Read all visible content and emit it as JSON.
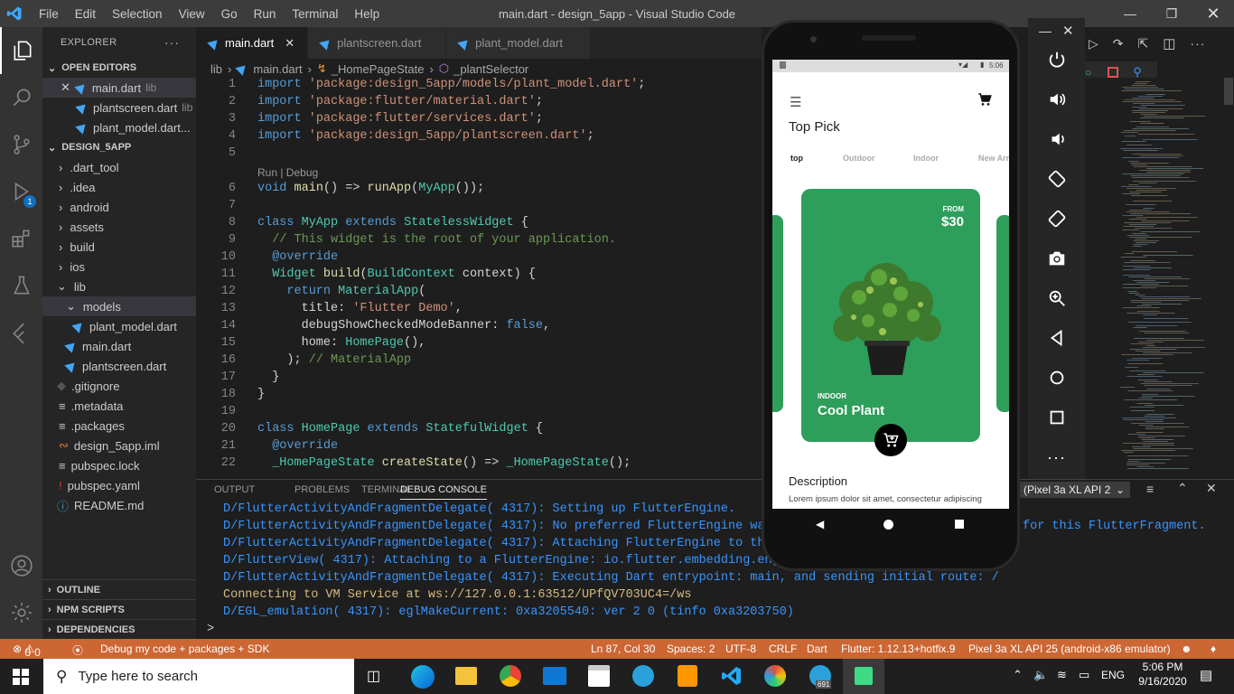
{
  "window": {
    "title": "main.dart - design_5app - Visual Studio Code",
    "menu": [
      "File",
      "Edit",
      "Selection",
      "View",
      "Go",
      "Run",
      "Terminal",
      "Help"
    ]
  },
  "sidebar": {
    "title": "EXPLORER",
    "open_editors_label": "OPEN EDITORS",
    "open_editors": [
      {
        "name": "main.dart",
        "hint": "lib"
      },
      {
        "name": "plantscreen.dart",
        "hint": "lib"
      },
      {
        "name": "plant_model.dart..."
      }
    ],
    "project_label": "DESIGN_5APP",
    "tree": [
      ".dart_tool",
      ".idea",
      "android",
      "assets",
      "build",
      "ios",
      "lib",
      "models",
      "plant_model.dart",
      "main.dart",
      "plantscreen.dart",
      ".gitignore",
      ".metadata",
      ".packages",
      "design_5app.iml",
      "pubspec.lock",
      "pubspec.yaml",
      "README.md"
    ],
    "outline": "OUTLINE",
    "npm": "NPM SCRIPTS",
    "deps": "DEPENDENCIES",
    "debug_badge": "1"
  },
  "tabs": [
    "main.dart",
    "plantscreen.dart",
    "plant_model.dart"
  ],
  "breadcrumb": [
    "lib",
    "main.dart",
    "_HomePageState",
    "_plantSelector"
  ],
  "editor": {
    "codelens": "Run | Debug",
    "line_numbers": [
      "1",
      "2",
      "3",
      "4",
      "5",
      "6",
      "7",
      "8",
      "9",
      "10",
      "11",
      "12",
      "13",
      "14",
      "15",
      "16",
      "17",
      "18",
      "19",
      "20",
      "21",
      "22"
    ]
  },
  "panel": {
    "tabs": [
      "OUTPUT",
      "PROBLEMS",
      "TERMINAL",
      "DEBUG CONSOLE"
    ],
    "device": "(Pixel 3a XL API 2",
    "console": [
      "D/FlutterActivityAndFragmentDelegate( 4317): Setting up FlutterEngine.",
      "D/FlutterActivityAndFragmentDelegate( 4317): No preferred FlutterEngine was p",
      "D/FlutterActivityAndFragmentDelegate( 4317): Attaching FlutterEngine to the A",
      "D/FlutterView( 4317): Attaching to a FlutterEngine: io.flutter.embedding.engine",
      "D/FlutterActivityAndFragmentDelegate( 4317): Executing Dart entrypoint: main, and sending initial route: /",
      "Connecting to VM Service at ws://127.0.0.1:63512/UPfQV703UC4=/ws",
      "D/EGL_emulation( 4317): eglMakeCurrent: 0xa3205540: ver 2 0 (tinfo 0xa3203750)"
    ],
    "console_tail": "for this FlutterFragment.",
    "prompt": ">"
  },
  "status": {
    "errors": "0",
    "warnings": "0",
    "debug": "Debug my code + packages + SDK",
    "position": "Ln 87, Col 30",
    "spaces": "Spaces: 2",
    "encoding": "UTF-8",
    "eol": "CRLF",
    "lang": "Dart",
    "flutter": "Flutter: 1.12.13+hotfix.9",
    "device": "Pixel 3a XL API 25 (android-x86 emulator)"
  },
  "taskbar": {
    "search_placeholder": "Type here to search",
    "time": "5:06 PM",
    "date": "9/16/2020",
    "lang": "ENG",
    "badge": "691"
  },
  "app": {
    "statusbar_time": "5:06",
    "title": "Top Pick",
    "tabs": [
      "top",
      "Outdoor",
      "Indoor",
      "New Arr"
    ],
    "card": {
      "from": "FROM",
      "price": "$30",
      "category": "INDOOR",
      "name": "Cool Plant"
    },
    "desc_title": "Description",
    "desc_text": "Lorem ipsum dolor sit amet, consectetur adipiscing"
  },
  "colors": {
    "accent": "#3ea6ff",
    "status_bar": "#cc6633",
    "card": "#2e9e5b"
  }
}
